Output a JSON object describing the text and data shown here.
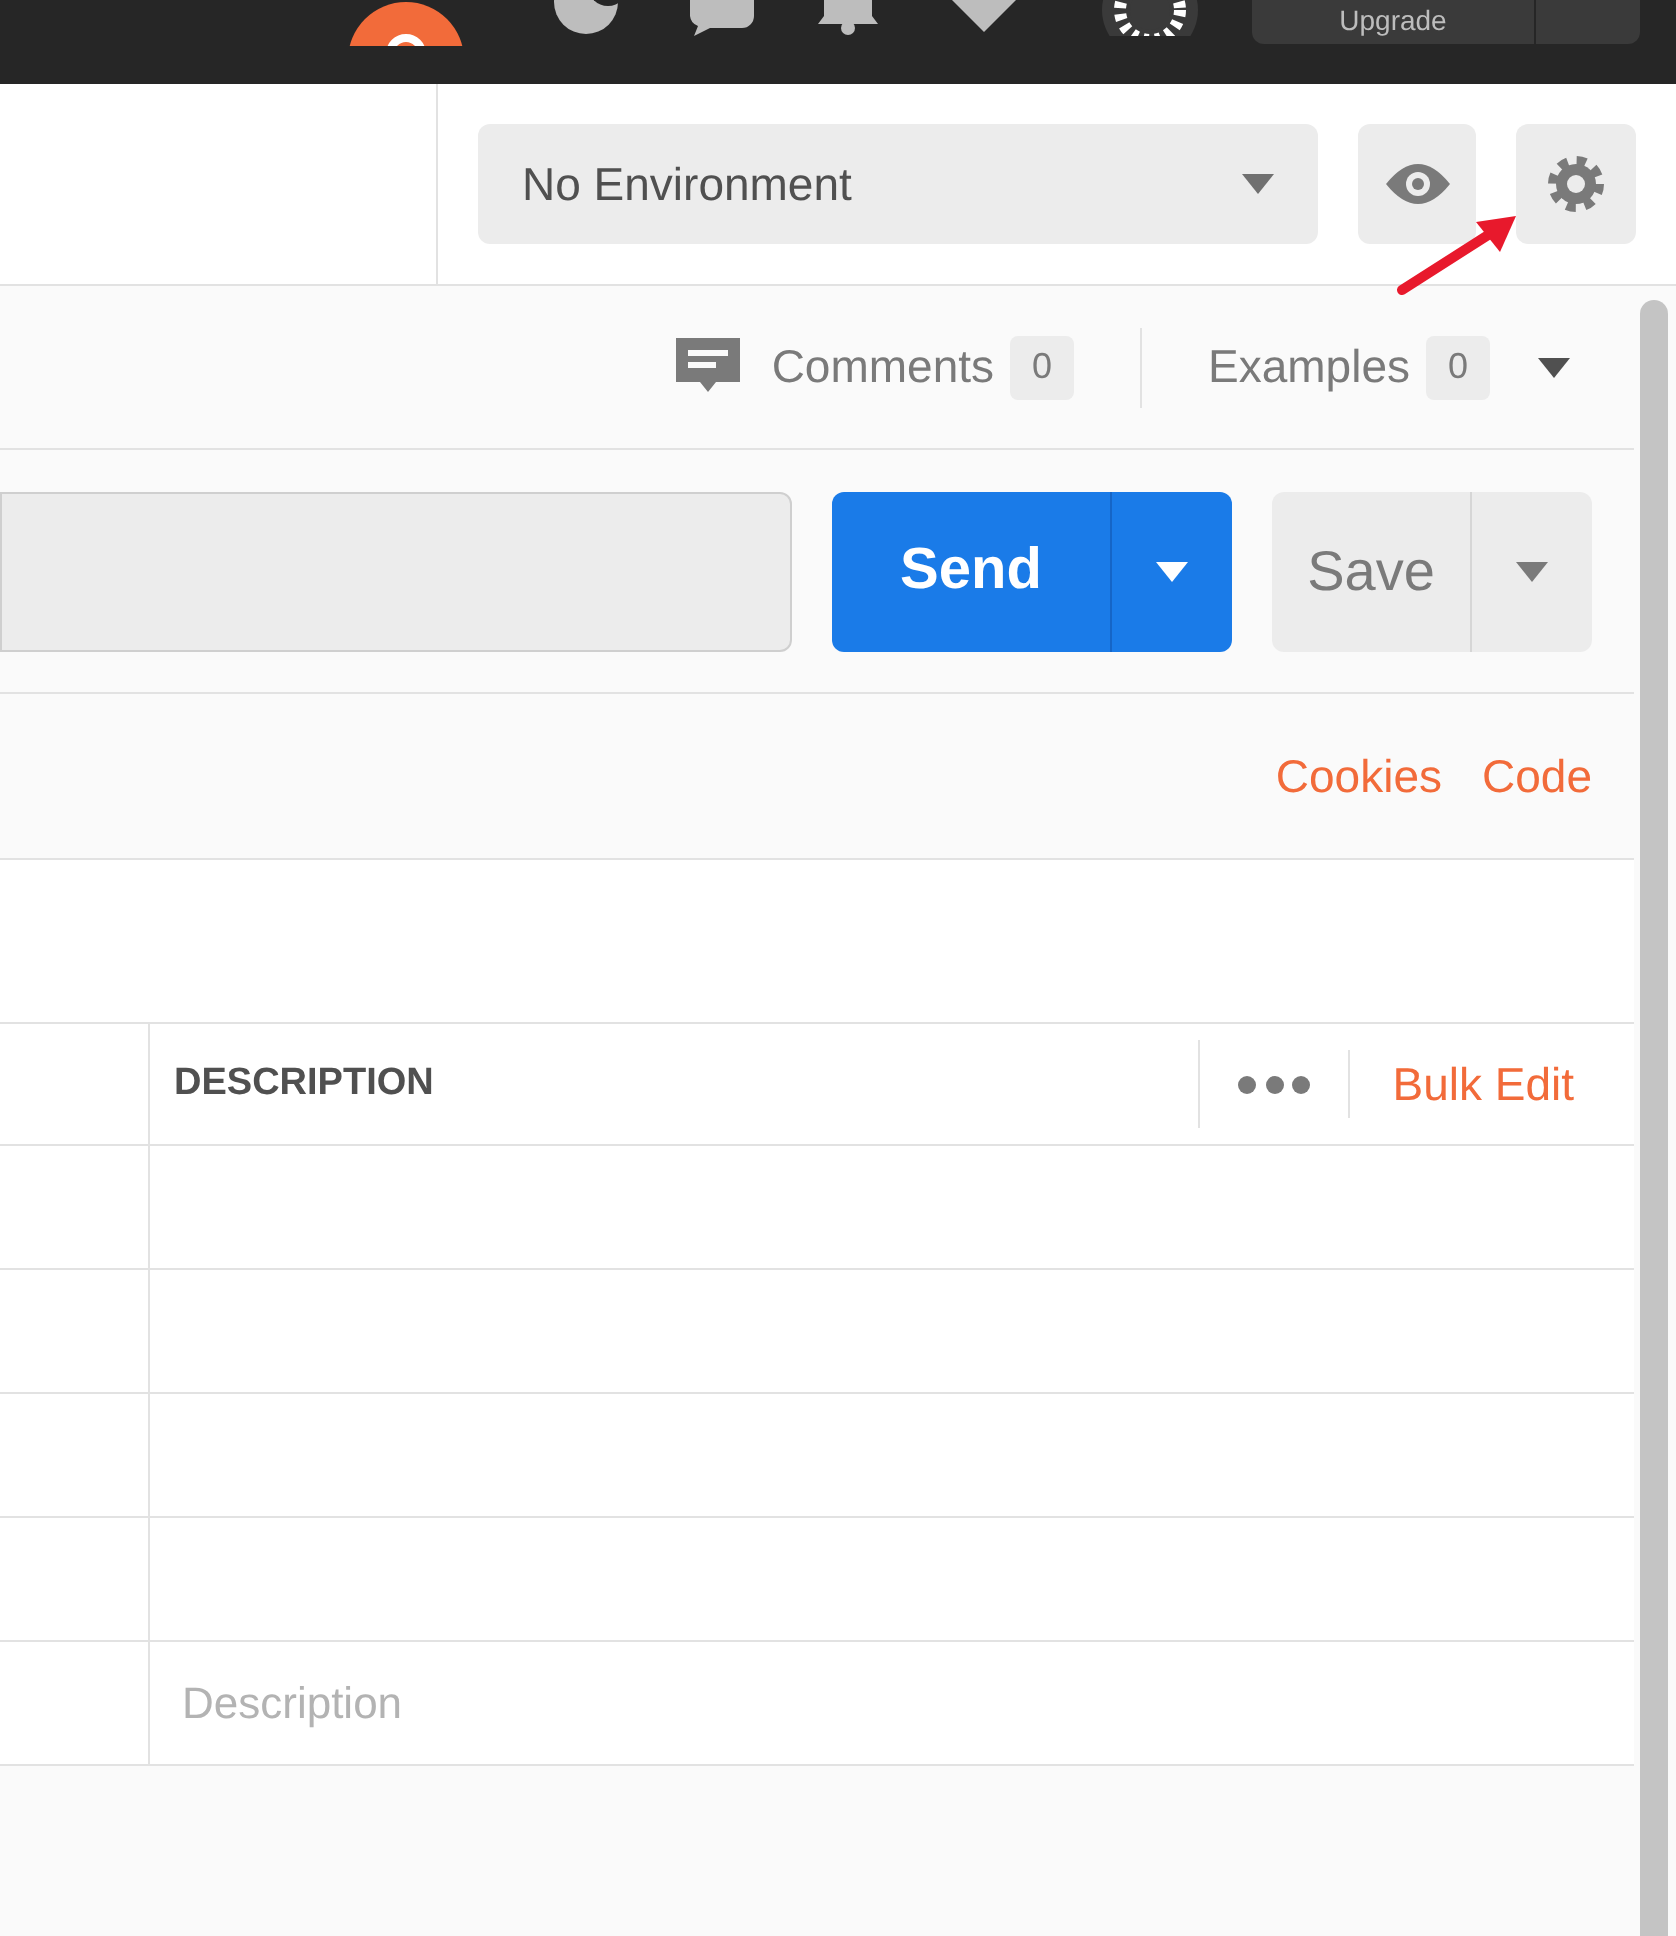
{
  "top_bar": {
    "upgrade_button": "Upgrade"
  },
  "environment": {
    "selected": "No Environment"
  },
  "request_header": {
    "comments": {
      "label": "Comments",
      "count": "0"
    },
    "examples": {
      "label": "Examples",
      "count": "0"
    }
  },
  "send_button": "Send",
  "save_button": "Save",
  "links": [
    "Cookies",
    "Code"
  ],
  "params_table": {
    "columns": [
      "DESCRIPTION"
    ],
    "bulk_edit": "Bulk Edit",
    "new_row": {
      "placeholder": "Description"
    }
  }
}
